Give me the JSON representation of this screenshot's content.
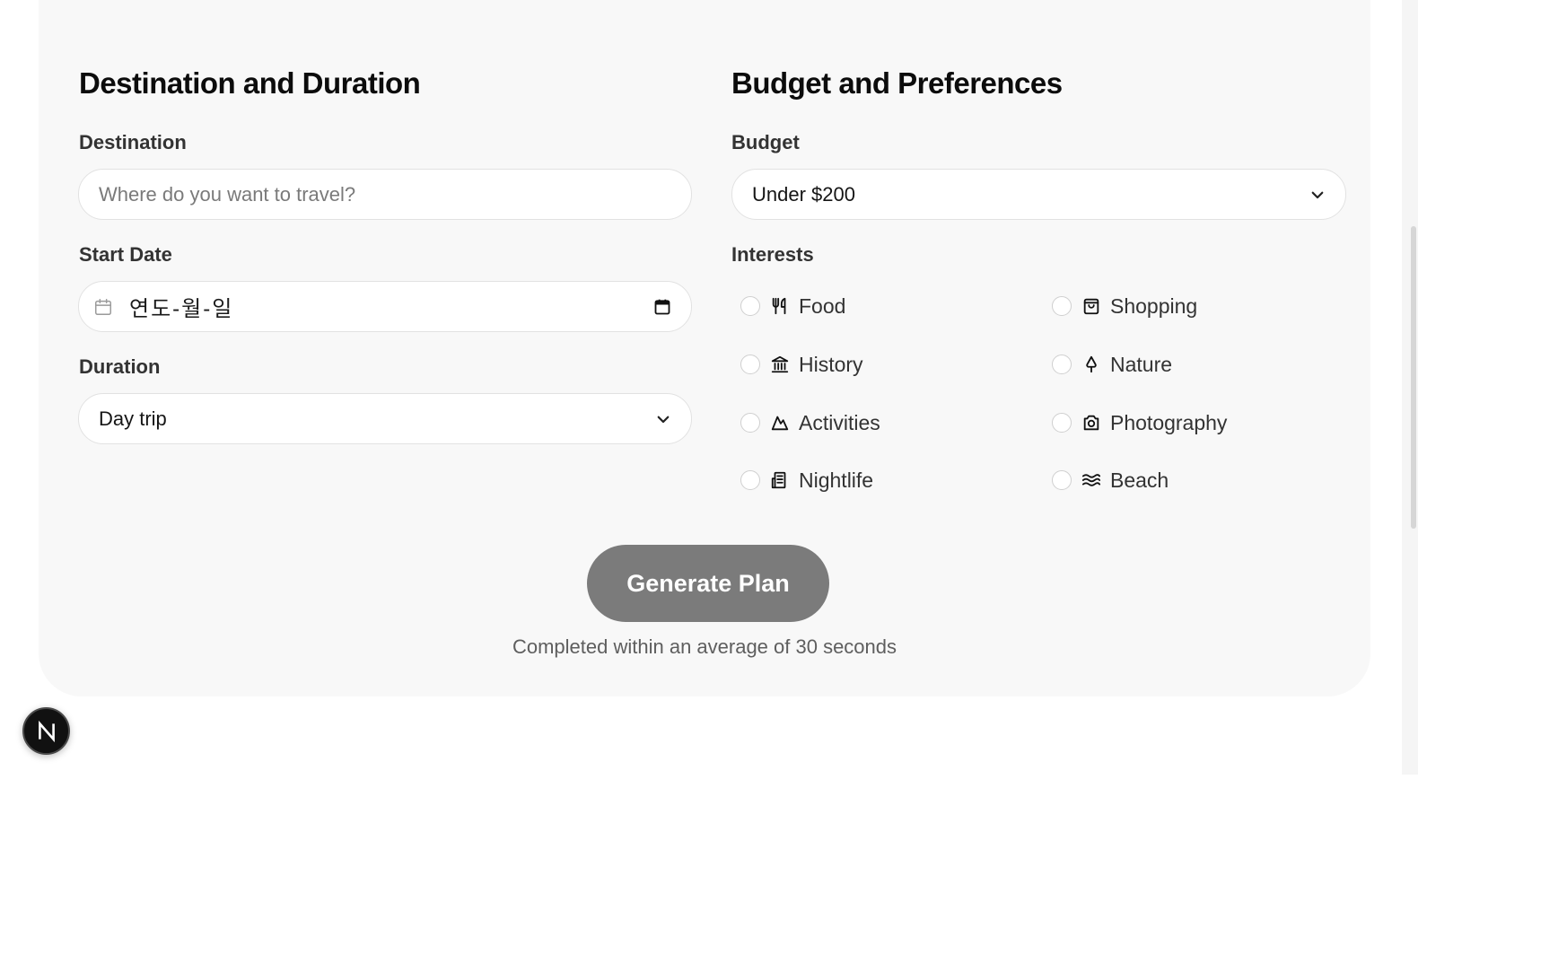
{
  "left_section": {
    "title": "Destination and Duration",
    "destination": {
      "label": "Destination",
      "placeholder": "Where do you want to travel?"
    },
    "start_date": {
      "label": "Start Date",
      "value": "연도-월-일"
    },
    "duration": {
      "label": "Duration",
      "selected": "Day trip"
    }
  },
  "right_section": {
    "title": "Budget and Preferences",
    "budget": {
      "label": "Budget",
      "selected": "Under $200"
    },
    "interests": {
      "label": "Interests",
      "items": [
        {
          "label": "Food",
          "icon": "utensils-icon"
        },
        {
          "label": "Shopping",
          "icon": "shopping-bag-icon"
        },
        {
          "label": "History",
          "icon": "landmark-icon"
        },
        {
          "label": "Nature",
          "icon": "tree-icon"
        },
        {
          "label": "Activities",
          "icon": "mountain-icon"
        },
        {
          "label": "Photography",
          "icon": "camera-icon"
        },
        {
          "label": "Nightlife",
          "icon": "building-icon"
        },
        {
          "label": "Beach",
          "icon": "waves-icon"
        }
      ]
    }
  },
  "actions": {
    "generate_label": "Generate Plan",
    "note": "Completed within an average of 30 seconds"
  },
  "badge": {
    "letter": "N"
  },
  "colors": {
    "card_bg": "#f8f8f8",
    "button_bg": "#7b7b7b",
    "badge_bg": "#111111"
  }
}
